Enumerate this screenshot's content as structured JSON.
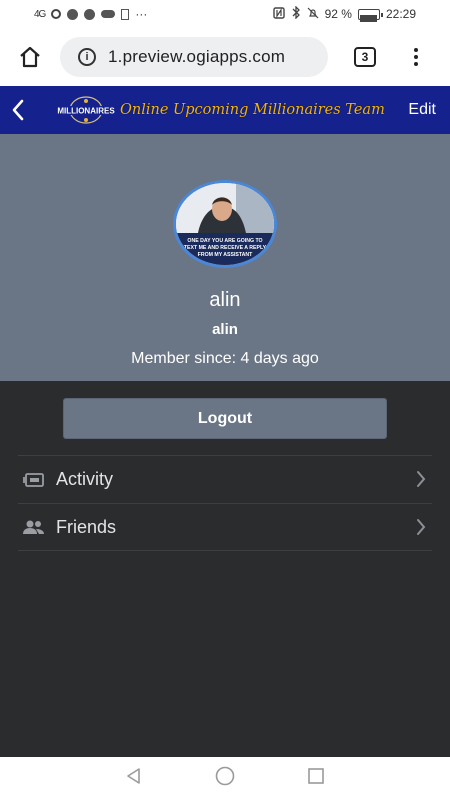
{
  "status_bar": {
    "network": "4G",
    "battery_percent_label": "92 %",
    "battery_level": 0.92,
    "time": "22:29",
    "more": "···"
  },
  "browser": {
    "url": "1.preview.ogiapps.com",
    "tab_count": "3",
    "info_symbol": "i"
  },
  "app_header": {
    "logo_text": "MILLIONAIRES",
    "title": "Online Upcoming Millionaires Team",
    "edit_label": "Edit"
  },
  "profile": {
    "avatar_caption": "ONE DAY YOU ARE GOING TO TEXT ME AND RECEIVE A REPLY FROM MY ASSISTANT",
    "display_name": "alin",
    "username": "alin",
    "member_since": "Member since: 4 days ago"
  },
  "actions": {
    "logout_label": "Logout"
  },
  "menu": [
    {
      "label": "Activity",
      "icon": "ticket-icon"
    },
    {
      "label": "Friends",
      "icon": "people-icon"
    }
  ],
  "colors": {
    "header_bg": "#15228d",
    "title_gold": "#f2b413",
    "profile_bg": "#6a7585",
    "page_bg": "#2b2c2e"
  }
}
